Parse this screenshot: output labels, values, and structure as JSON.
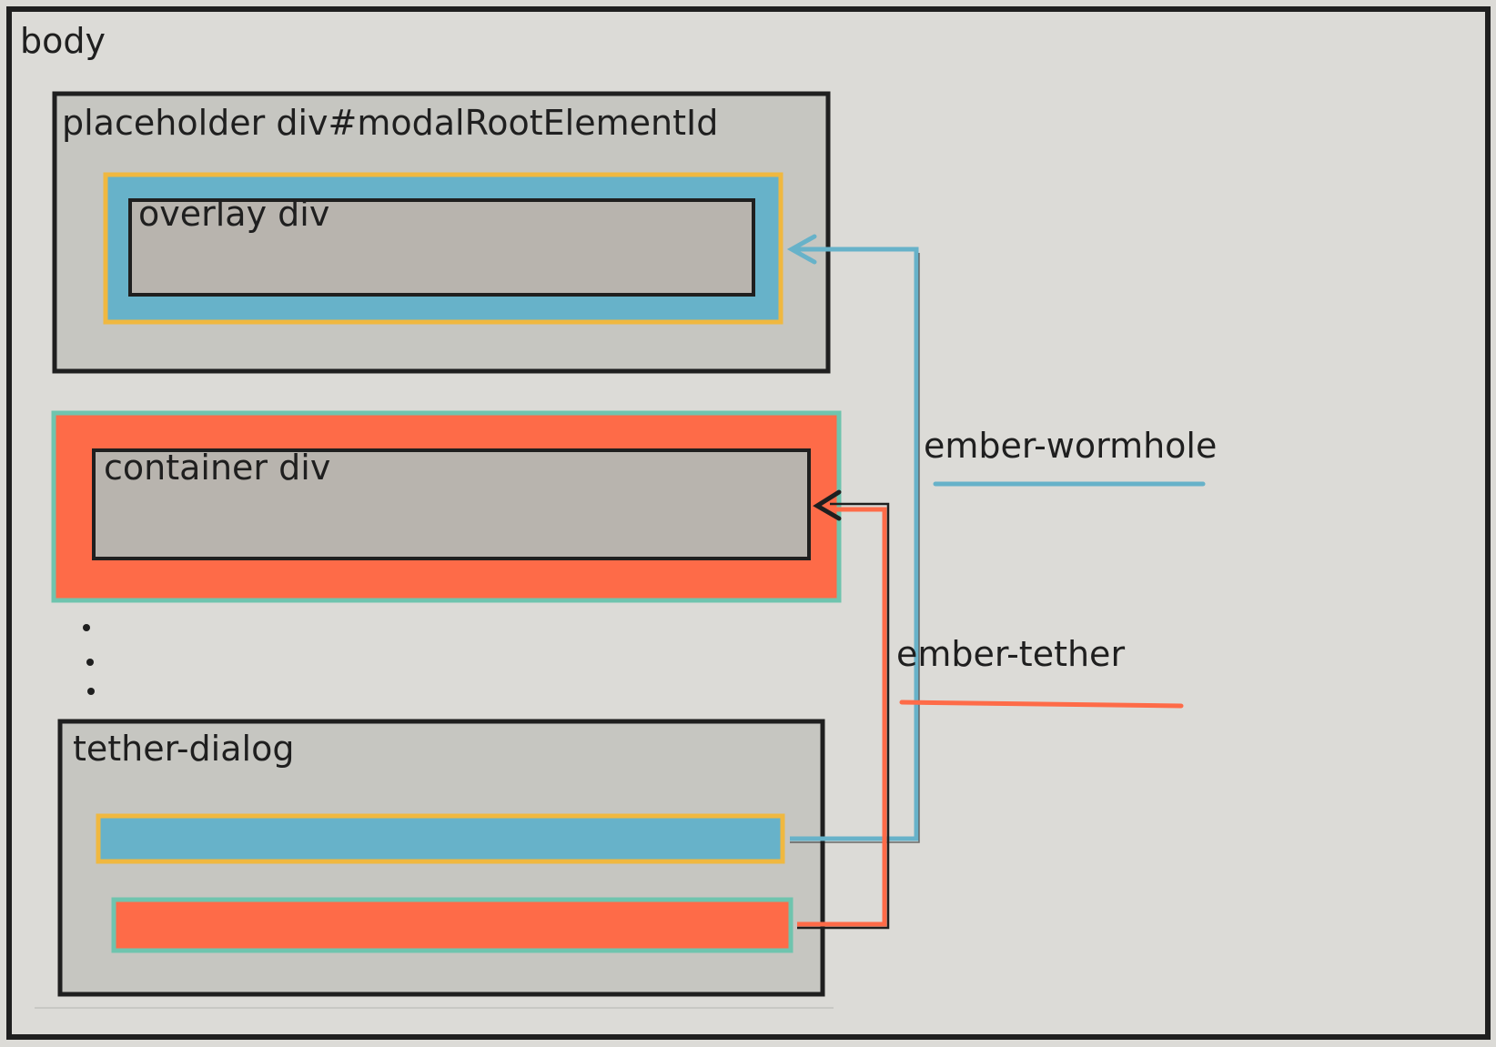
{
  "labels": {
    "body": "body",
    "placeholder": "placeholder div#modalRootElementId",
    "overlay": "overlay div",
    "container": "container div",
    "tether_dialog": "tether-dialog",
    "wormhole": "ember-wormhole",
    "tether": "ember-tether"
  },
  "colors": {
    "paper": "#dcdbd7",
    "outer_gray": "#c6c6c1",
    "inner_gray": "#b8b4ae",
    "blue": "#67b2c9",
    "yellow": "#f0b840",
    "orange": "#fe6b48",
    "teal": "#6fc4ae",
    "ink": "#1f1f1f"
  },
  "dots": "⋮"
}
